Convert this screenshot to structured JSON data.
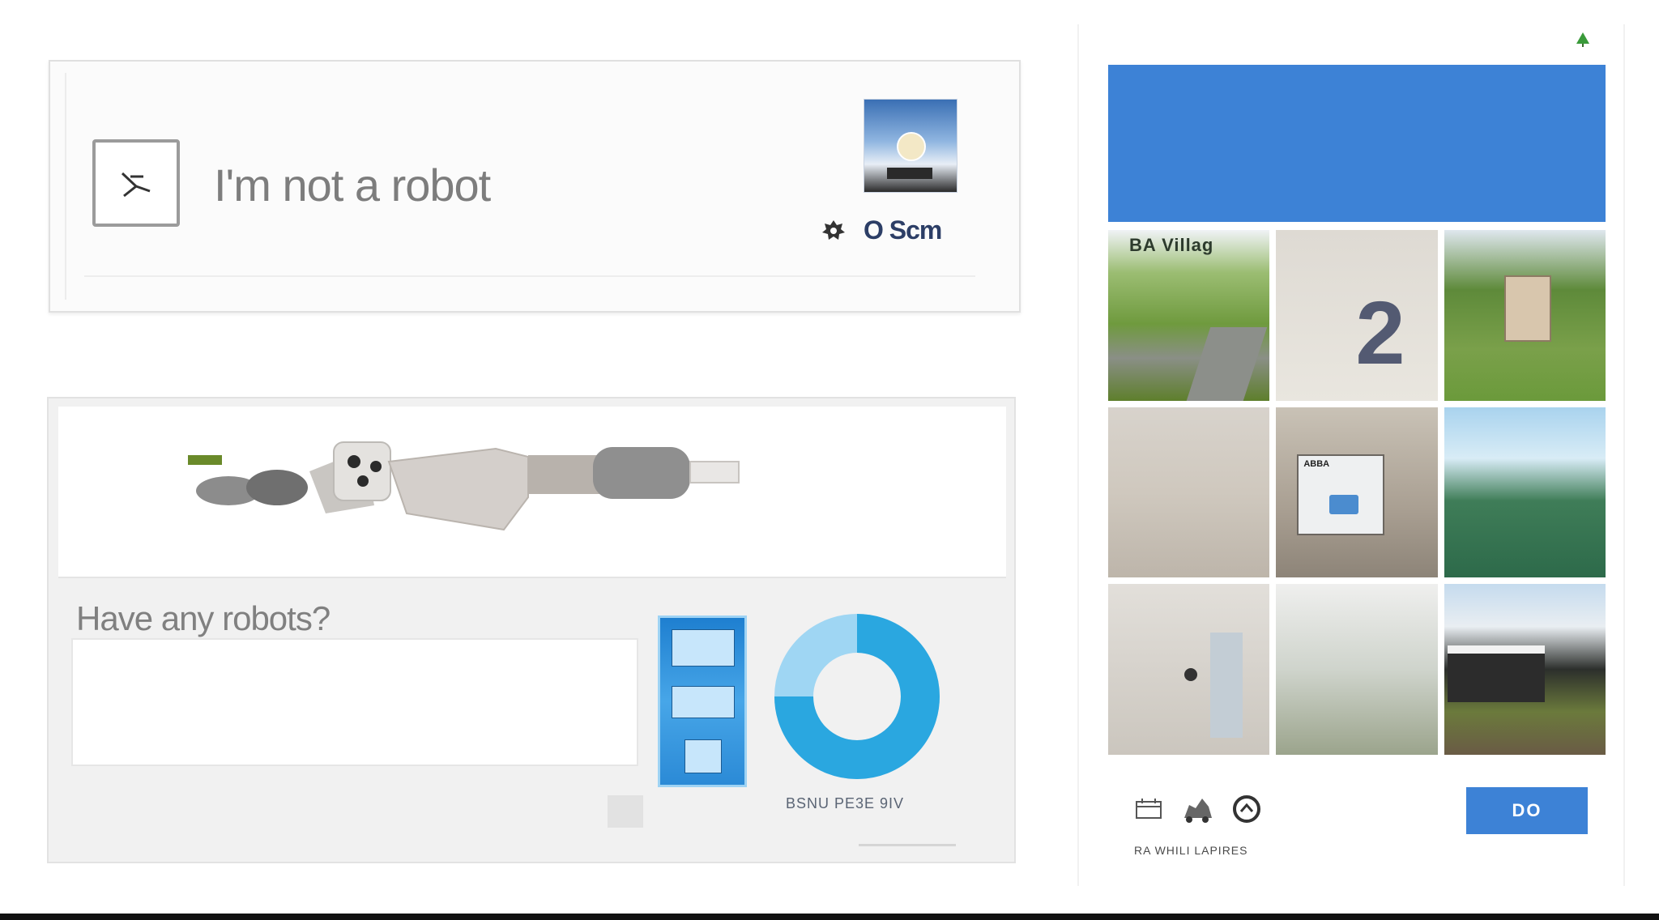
{
  "checkbox_widget": {
    "label": "I'm not a robot",
    "privacy_terms": "O Scm",
    "footer": ""
  },
  "challenge": {
    "question": "Have any robots?",
    "answer_value": "",
    "answer_placeholder": "",
    "chart_caption": "BSNU PE3E 9IV"
  },
  "grid_challenge": {
    "header_line1": "",
    "header_line2": "",
    "tiles": [
      {
        "label": "BA Villag"
      },
      {
        "digit": "2"
      },
      {},
      {},
      {
        "label": "ABBA"
      },
      {},
      {},
      {},
      {}
    ],
    "footer_text": "RA WHILI LAPIRES",
    "verify_label": "DO"
  },
  "colors": {
    "accent_blue": "#3d82d6",
    "chart_cyan": "#2aa7e0",
    "corner_green": "#3a9a3a"
  },
  "icons": {
    "refresh": "refresh-icon",
    "audio": "audio-icon",
    "info": "info-icon"
  }
}
